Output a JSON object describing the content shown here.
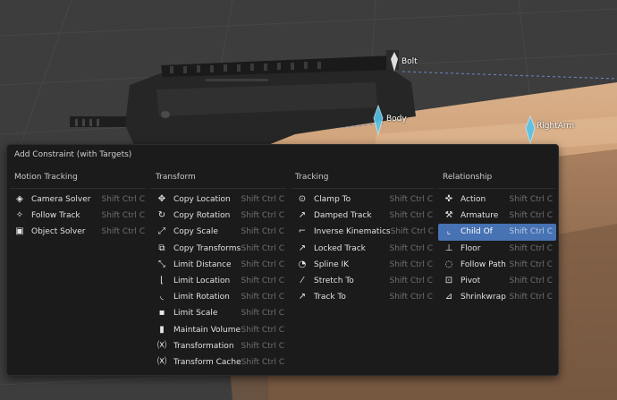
{
  "bones": {
    "bolt": "Bolt",
    "body": "Body",
    "right_arm": "RightArm"
  },
  "menu": {
    "title": "Add Constraint (with Targets)",
    "accent": "#4772b3",
    "columns": [
      {
        "heading": "Motion Tracking",
        "items": [
          {
            "label": "Camera Solver",
            "shortcut": "Shift Ctrl C",
            "icon": "camera-solver-icon"
          },
          {
            "label": "Follow Track",
            "shortcut": "Shift Ctrl C",
            "icon": "follow-track-icon"
          },
          {
            "label": "Object Solver",
            "shortcut": "Shift Ctrl C",
            "icon": "object-solver-icon"
          }
        ]
      },
      {
        "heading": "Transform",
        "items": [
          {
            "label": "Copy Location",
            "shortcut": "Shift Ctrl C",
            "icon": "copy-location-icon"
          },
          {
            "label": "Copy Rotation",
            "shortcut": "Shift Ctrl C",
            "icon": "copy-rotation-icon"
          },
          {
            "label": "Copy Scale",
            "shortcut": "Shift Ctrl C",
            "icon": "copy-scale-icon"
          },
          {
            "label": "Copy Transforms",
            "shortcut": "Shift Ctrl C",
            "icon": "copy-transforms-icon"
          },
          {
            "label": "Limit Distance",
            "shortcut": "Shift Ctrl C",
            "icon": "limit-distance-icon"
          },
          {
            "label": "Limit Location",
            "shortcut": "Shift Ctrl C",
            "icon": "limit-location-icon"
          },
          {
            "label": "Limit Rotation",
            "shortcut": "Shift Ctrl C",
            "icon": "limit-rotation-icon"
          },
          {
            "label": "Limit Scale",
            "shortcut": "Shift Ctrl C",
            "icon": "limit-scale-icon"
          },
          {
            "label": "Maintain Volume",
            "shortcut": "Shift Ctrl C",
            "icon": "maintain-volume-icon"
          },
          {
            "label": "Transformation",
            "shortcut": "Shift Ctrl C",
            "icon": "transformation-icon"
          },
          {
            "label": "Transform Cache",
            "shortcut": "Shift Ctrl C",
            "icon": "transform-cache-icon"
          }
        ]
      },
      {
        "heading": "Tracking",
        "items": [
          {
            "label": "Clamp To",
            "shortcut": "Shift Ctrl C",
            "icon": "clamp-to-icon"
          },
          {
            "label": "Damped Track",
            "shortcut": "Shift Ctrl C",
            "icon": "damped-track-icon"
          },
          {
            "label": "Inverse Kinematics",
            "shortcut": "Shift Ctrl C",
            "icon": "inverse-kinematics-icon"
          },
          {
            "label": "Locked Track",
            "shortcut": "Shift Ctrl C",
            "icon": "locked-track-icon"
          },
          {
            "label": "Spline IK",
            "shortcut": "Shift Ctrl C",
            "icon": "spline-ik-icon"
          },
          {
            "label": "Stretch To",
            "shortcut": "Shift Ctrl C",
            "icon": "stretch-to-icon"
          },
          {
            "label": "Track To",
            "shortcut": "Shift Ctrl C",
            "icon": "track-to-icon"
          }
        ]
      },
      {
        "heading": "Relationship",
        "items": [
          {
            "label": "Action",
            "shortcut": "Shift Ctrl C",
            "icon": "action-icon"
          },
          {
            "label": "Armature",
            "shortcut": "Shift Ctrl C",
            "icon": "armature-icon"
          },
          {
            "label": "Child Of",
            "shortcut": "Shift Ctrl C",
            "icon": "child-of-icon",
            "highlighted": true
          },
          {
            "label": "Floor",
            "shortcut": "Shift Ctrl C",
            "icon": "floor-icon"
          },
          {
            "label": "Follow Path",
            "shortcut": "Shift Ctrl C",
            "icon": "follow-path-icon"
          },
          {
            "label": "Pivot",
            "shortcut": "Shift Ctrl C",
            "icon": "pivot-icon"
          },
          {
            "label": "Shrinkwrap",
            "shortcut": "Shift Ctrl C",
            "icon": "shrinkwrap-icon"
          }
        ]
      }
    ]
  }
}
